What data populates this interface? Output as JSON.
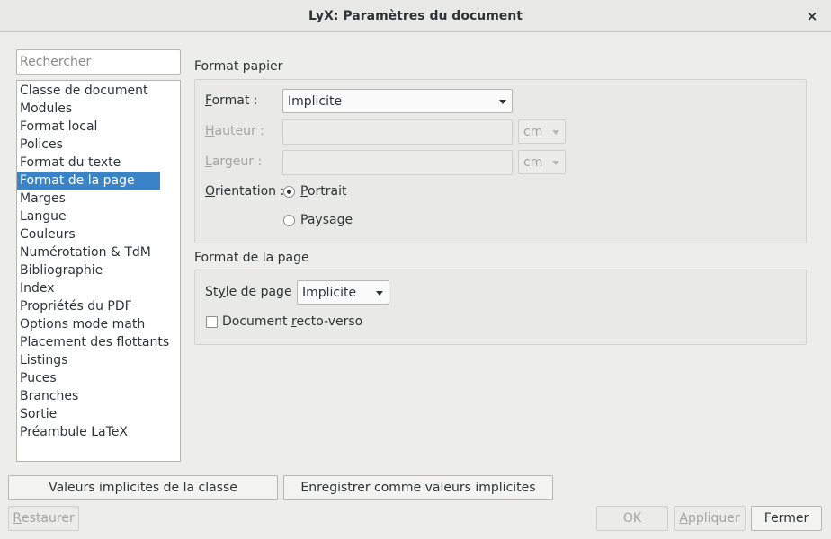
{
  "window": {
    "title": "LyX: Paramètres du document",
    "close_icon": "×"
  },
  "search": {
    "placeholder": "Rechercher",
    "value": ""
  },
  "sidebar": {
    "items": [
      {
        "label": "Classe de document"
      },
      {
        "label": "Modules"
      },
      {
        "label": "Format local"
      },
      {
        "label": "Polices"
      },
      {
        "label": "Format du texte"
      },
      {
        "label": "Format de la page",
        "selected": true
      },
      {
        "label": "Marges"
      },
      {
        "label": "Langue"
      },
      {
        "label": "Couleurs"
      },
      {
        "label": "Numérotation & TdM"
      },
      {
        "label": "Bibliographie"
      },
      {
        "label": "Index"
      },
      {
        "label": "Propriétés du PDF"
      },
      {
        "label": "Options mode math"
      },
      {
        "label": "Placement des flottants"
      },
      {
        "label": "Listings"
      },
      {
        "label": "Puces"
      },
      {
        "label": "Branches"
      },
      {
        "label": "Sortie"
      },
      {
        "label": "Préambule LaTeX"
      }
    ]
  },
  "paper": {
    "group_title": "Format papier",
    "format_label_u": "F",
    "format_label_rest": "ormat :",
    "format_value": "Implicite",
    "height_label_u": "H",
    "height_label_rest": "auteur :",
    "height_unit": "cm",
    "width_label_u": "L",
    "width_label_rest": "argeur :",
    "width_unit": "cm",
    "orientation_label_u": "O",
    "orientation_label_rest": "rientation :",
    "portrait_u": "P",
    "portrait_rest": "ortrait",
    "landscape_pre": "Pa",
    "landscape_u": "y",
    "landscape_rest": "sage",
    "orientation_selected": "portrait"
  },
  "page": {
    "group_title": "Format de la page",
    "style_label_pre": "St",
    "style_label_u": "y",
    "style_label_rest": "le de page :",
    "style_value": "Implicite",
    "recto_pre": "Document ",
    "recto_u": "r",
    "recto_rest": "ecto-verso",
    "recto_checked": false
  },
  "buttons": {
    "class_defaults": "Valeurs implicites de la classe",
    "save_defaults": "Enregistrer comme valeurs implicites",
    "restore_u": "R",
    "restore_rest": "estaurer",
    "ok": "OK",
    "apply_u": "A",
    "apply_rest": "ppliquer",
    "close": "Fermer"
  }
}
